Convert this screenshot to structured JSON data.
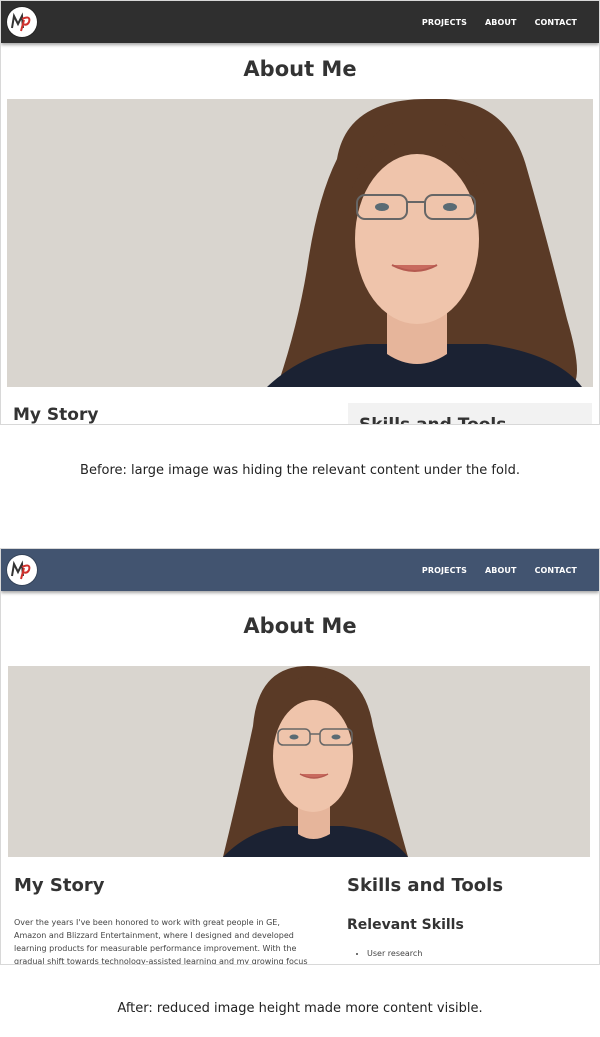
{
  "before": {
    "nav": {
      "logo_text": "MP",
      "items": [
        {
          "label": "PROJECTS"
        },
        {
          "label": "ABOUT"
        },
        {
          "label": "CONTACT"
        }
      ]
    },
    "page_title": "About Me",
    "hero_image": "portrait of woman with curly hair and glasses",
    "story_title": "My Story",
    "skills_title": "Skills and Tools"
  },
  "caption_before": "Before: large image was hiding the relevant content under the fold.",
  "after": {
    "nav": {
      "logo_text": "MP",
      "items": [
        {
          "label": "PROJECTS"
        },
        {
          "label": "ABOUT"
        },
        {
          "label": "CONTACT"
        }
      ]
    },
    "page_title": "About Me",
    "hero_image": "portrait of woman with curly hair and glasses",
    "story_title": "My Story",
    "story_text": "Over the years I've been honored to work with great people in GE, Amazon and Blizzard Entertainment, where I designed and developed learning products for measurable performance improvement. With the gradual shift towards technology-assisted learning and my growing focus on e-learning, rather than",
    "skills_title": "Skills and Tools",
    "relevant_skills_title": "Relevant Skills",
    "skills": [
      "User research"
    ]
  },
  "caption_after": "After: reduced image height made more content visible.",
  "colors": {
    "navbar_before": "#2f2f2f",
    "navbar_after": "#425470",
    "logo_accent": "#d0312d"
  }
}
